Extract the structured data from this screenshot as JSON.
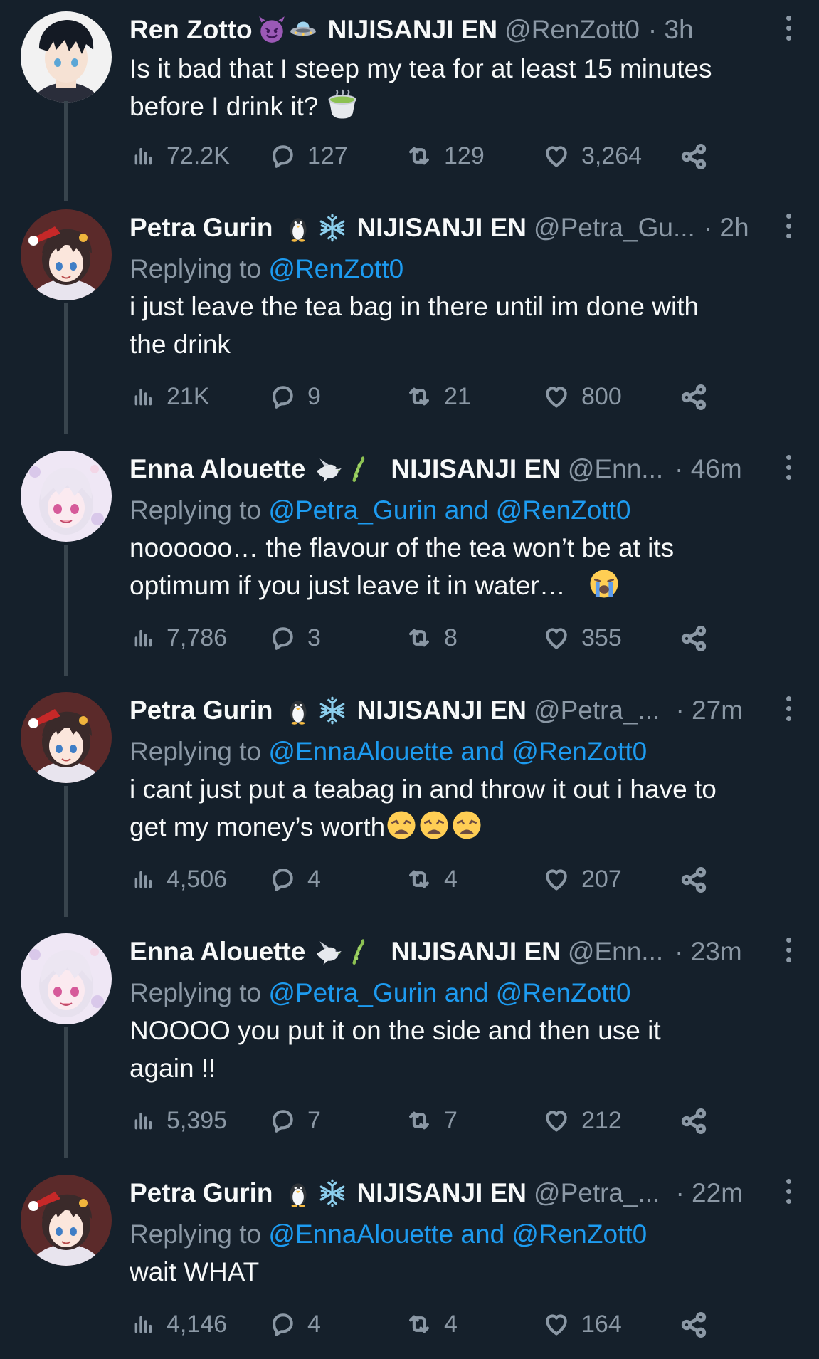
{
  "colors": {
    "background": "#15202b",
    "text": "#f7f9f9",
    "secondary": "#8b98a5",
    "accent": "#1d9bf0",
    "thread_line": "#38444d"
  },
  "icons": {
    "views": "bar-chart-icon",
    "replies": "speech-bubble-icon",
    "retweets": "retweet-icon",
    "likes": "heart-icon",
    "share": "share-icon",
    "more": "more-options-icon"
  },
  "tweets": [
    {
      "name": "Ren Zotto",
      "badges": [
        "smiling-devil-emoji",
        "ufo-emoji"
      ],
      "affiliation": "NIJISANJI EN",
      "handle": "@RenZott0",
      "time": "· 3h",
      "replying_prefix": "",
      "replying_to": "",
      "text_lines": [
        "Is it bad that I steep my tea for at least 15 minutes",
        "before I drink it?"
      ],
      "trailing_emoji": "matcha-tea-emoji",
      "views": "72.2K",
      "replies": "127",
      "retweets": "129",
      "likes": "3,264"
    },
    {
      "name": "Petra Gurin",
      "badges": [
        "penguin-emoji",
        "snowflake-emoji"
      ],
      "affiliation": "NIJISANJI EN",
      "handle": "@Petra_Gu...",
      "time": "· 2h",
      "replying_prefix": "Replying to ",
      "replying_to": "@RenZott0",
      "text_lines": [
        "i just leave the tea bag in there until im done with",
        "the drink"
      ],
      "views": "21K",
      "replies": "9",
      "retweets": "21",
      "likes": "800"
    },
    {
      "name": "Enna Alouette",
      "badges": [
        "dove-emoji",
        "bean-pod-emoji"
      ],
      "affiliation": "NIJISANJI EN",
      "handle": "@Enn...",
      "time": "· 46m",
      "replying_prefix": "Replying to ",
      "replying_to": "@Petra_Gurin and @RenZott0",
      "text_lines": [
        "noooooo… the flavour of the tea won’t be at its",
        "optimum if you just leave it in water…"
      ],
      "trailing_emoji": "loudly-crying-emoji",
      "views": "7,786",
      "replies": "3",
      "retweets": "8",
      "likes": "355"
    },
    {
      "name": "Petra Gurin",
      "badges": [
        "penguin-emoji",
        "snowflake-emoji"
      ],
      "affiliation": "NIJISANJI EN",
      "handle": "@Petra_...",
      "time": "· 27m",
      "replying_prefix": "Replying to ",
      "replying_to": "@EnnaAlouette and @RenZott0",
      "text_lines": [
        "i cant just put a teabag in and throw it out i have to",
        "get my money’s worth"
      ],
      "trailing_emoji": "weary-face-emoji x3",
      "views": "4,506",
      "replies": "4",
      "retweets": "4",
      "likes": "207"
    },
    {
      "name": "Enna Alouette",
      "badges": [
        "dove-emoji",
        "bean-pod-emoji"
      ],
      "affiliation": "NIJISANJI EN",
      "handle": "@Enn...",
      "time": "· 23m",
      "replying_prefix": "Replying to ",
      "replying_to": "@Petra_Gurin and @RenZott0",
      "text_lines": [
        "NOOOO you put it on the side and then use it",
        "again !!"
      ],
      "views": "5,395",
      "replies": "7",
      "retweets": "7",
      "likes": "212"
    },
    {
      "name": "Petra Gurin",
      "badges": [
        "penguin-emoji",
        "snowflake-emoji"
      ],
      "affiliation": "NIJISANJI EN",
      "handle": "@Petra_...",
      "time": "· 22m",
      "replying_prefix": "Replying to ",
      "replying_to": "@EnnaAlouette and @RenZott0",
      "text_lines": [
        "wait WHAT"
      ],
      "views": "4,146",
      "replies": "4",
      "retweets": "4",
      "likes": "164"
    }
  ]
}
